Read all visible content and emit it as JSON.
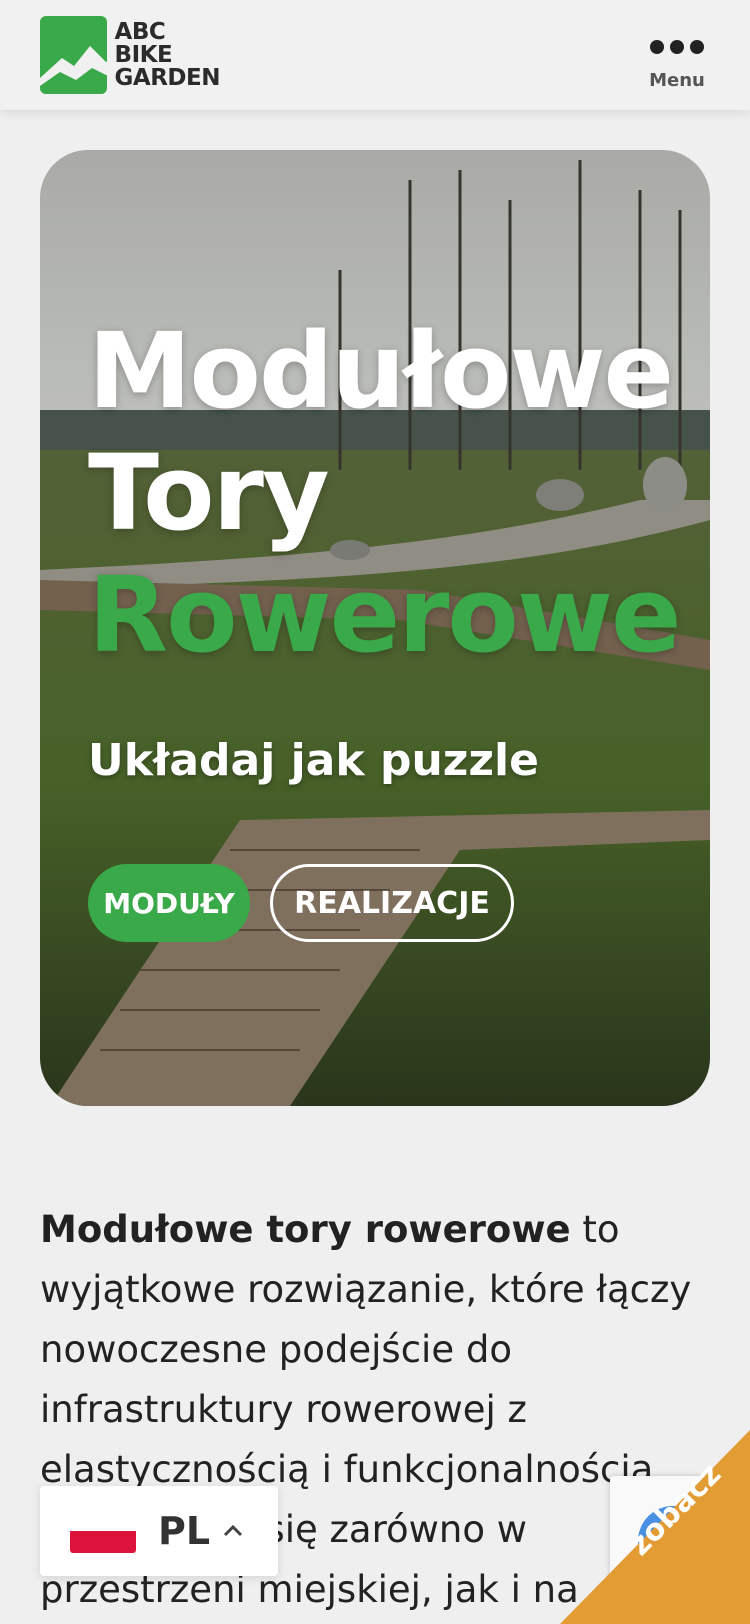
{
  "header": {
    "logo": {
      "line1": "ABC",
      "line2": "BIKE",
      "line3": "GARDEN"
    },
    "menu_label": "Menu"
  },
  "hero": {
    "title_line1": "Modułowe",
    "title_line2": "Tory",
    "title_line3": "Rowerowe",
    "subtitle": "Układaj jak puzzle",
    "button_primary": "MODUŁY",
    "button_secondary": "REALIZACJE"
  },
  "intro": {
    "bold": "Modułowe tory rowerowe",
    "rest": " to wyjątkowe rozwiązanie, które łączy nowoczesne podejście do infrastruktury rowerowej z elastycznością i funkcjonalnością. Sprawdzają się zarówno w przestrzeni miejskiej, jak i na"
  },
  "language": {
    "code": "PL"
  },
  "corner": {
    "label": "zobacz"
  },
  "colors": {
    "green": "#3aa94a",
    "orange": "#e39b33",
    "background": "#efefef"
  }
}
